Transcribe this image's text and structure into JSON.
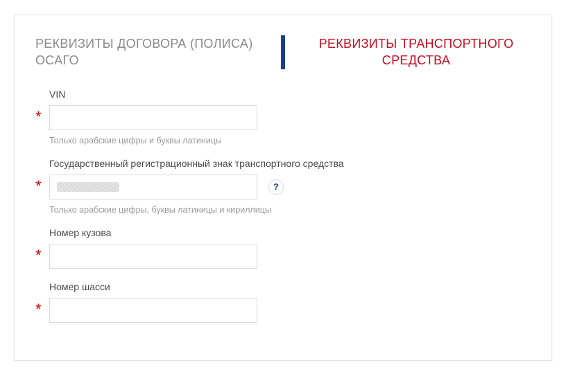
{
  "tabs": {
    "left": "РЕКВИЗИТЫ ДОГОВОРА (ПОЛИСА) ОСАГО",
    "right": "РЕКВИЗИТЫ ТРАНСПОРТНОГО СРЕДСТВА"
  },
  "fields": {
    "vin": {
      "label": "VIN",
      "value": "",
      "hint": "Только арабские цифры и буквы латиницы",
      "required_mark": "*"
    },
    "plate": {
      "label": "Государственный регистрационный знак транспортного средства",
      "value": "",
      "hint": "Только арабские цифры, буквы латиницы и кириллицы",
      "required_mark": "*",
      "help": "?"
    },
    "body": {
      "label": "Номер кузова",
      "value": "",
      "required_mark": "*"
    },
    "chassis": {
      "label": "Номер шасси",
      "value": "",
      "required_mark": "*"
    }
  }
}
